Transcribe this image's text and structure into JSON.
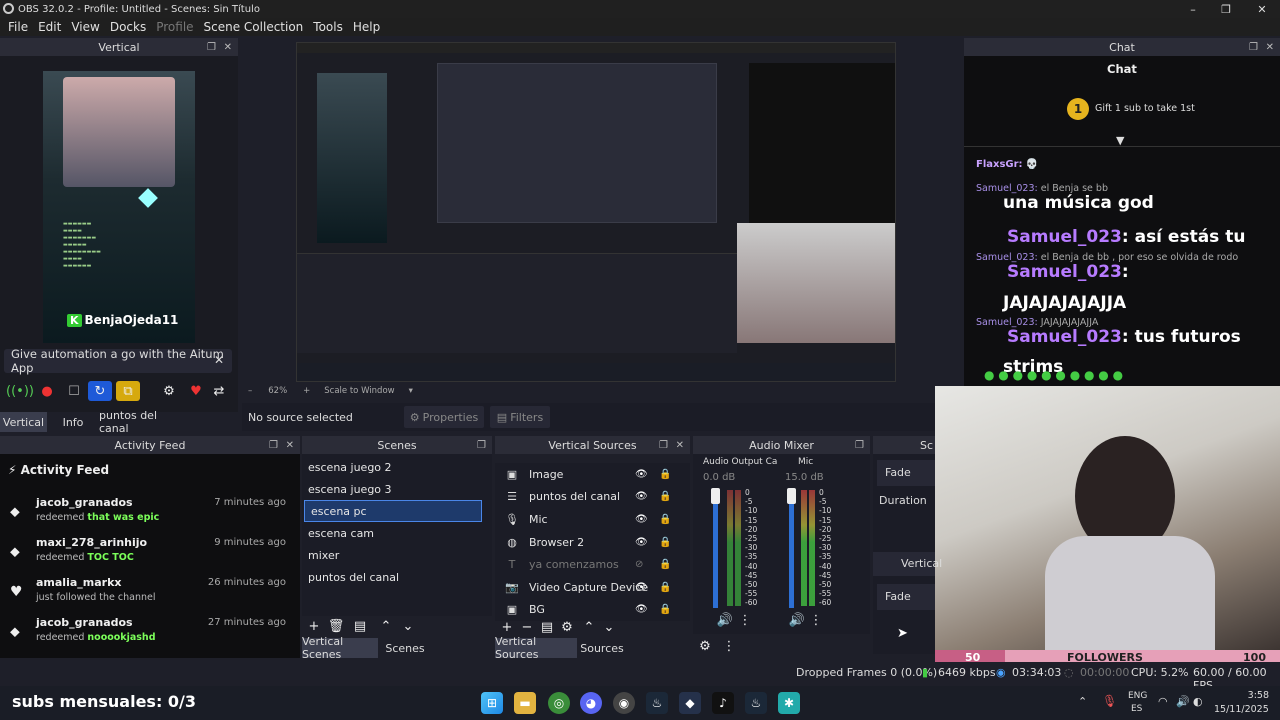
{
  "window": {
    "title": "OBS 32.0.2 - Profile: Untitled - Scenes: Sin Título",
    "controls": {
      "minimize": "–",
      "maximize": "❐",
      "close": "✕"
    }
  },
  "menu": [
    "File",
    "Edit",
    "View",
    "Docks",
    "Profile",
    "Scene Collection",
    "Tools",
    "Help"
  ],
  "vertical_dock": {
    "title": "Vertical",
    "preview_name": "BenjaOjeda11",
    "banner_text": "Give automation a go with the Aitum App",
    "tabs": [
      "Vertical",
      "Info",
      "puntos del canal"
    ]
  },
  "preview": {
    "zoom": "62%",
    "zoom_mode": "Scale to Window",
    "no_source_text": "No source selected",
    "properties_label": "Properties",
    "filters_label": "Filters"
  },
  "activity_feed": {
    "dock_title": "Activity Feed",
    "heading": "Activity Feed",
    "items": [
      {
        "user": "jacob_granados",
        "action": "redeemed",
        "detail": "that was epic",
        "time": "7 minutes ago",
        "icon": "points-icon"
      },
      {
        "user": "maxi_278_arinhijo",
        "action": "redeemed",
        "detail": "TOC TOC",
        "time": "9 minutes ago",
        "icon": "points-icon"
      },
      {
        "user": "amalia_markx",
        "action": "just followed the channel",
        "detail": "",
        "time": "26 minutes ago",
        "icon": "heart-icon"
      },
      {
        "user": "jacob_granados",
        "action": "redeemed",
        "detail": "nooookjashd",
        "time": "27 minutes ago",
        "icon": "points-icon"
      }
    ]
  },
  "scenes": {
    "title": "Scenes",
    "items": [
      "escena juego 2",
      "escena juego 3",
      "escena pc",
      "escena cam",
      "mixer",
      "puntos del canal"
    ],
    "selected": "escena pc",
    "tabs": [
      "Vertical Scenes",
      "Scenes"
    ]
  },
  "sources": {
    "title": "Vertical Sources",
    "items": [
      {
        "name": "Image",
        "icon": "image-icon",
        "visible": true
      },
      {
        "name": "puntos del canal",
        "icon": "list-icon",
        "visible": true
      },
      {
        "name": "Mic",
        "icon": "mic-icon",
        "visible": true
      },
      {
        "name": "Browser 2",
        "icon": "globe-icon",
        "visible": true
      },
      {
        "name": "ya comenzamos",
        "icon": "text-icon",
        "visible": false
      },
      {
        "name": "Video Capture Device",
        "icon": "camera-icon",
        "visible": true
      },
      {
        "name": "BG",
        "icon": "image-icon",
        "visible": true
      }
    ],
    "tabs": [
      "Vertical Sources",
      "Sources"
    ]
  },
  "audio_mixer": {
    "title": "Audio Mixer",
    "channels": [
      {
        "name": "Audio Output Ca",
        "db": "0.0 dB"
      },
      {
        "name": "Mic",
        "db": "15.0 dB"
      }
    ],
    "scale": [
      "0",
      "-5",
      "-10",
      "-15",
      "-20",
      "-25",
      "-30",
      "-35",
      "-40",
      "-45",
      "-50",
      "-55",
      "-60"
    ]
  },
  "transitions": {
    "title": "Sc",
    "fade": "Fade",
    "duration_label": "Duration",
    "vertical_label": "Vertical",
    "vertical_fade": "Fade"
  },
  "chat": {
    "dock_title": "Chat",
    "header": "Chat",
    "gift_rank": "1",
    "gift_text": "Gift 1 sub to take 1st",
    "lines": [
      {
        "user": "FlaxsGr:",
        "text": "💀"
      },
      {
        "user": "Samuel_023:",
        "text": "el Benja se bb"
      },
      {
        "user": "",
        "text": "una música god"
      },
      {
        "user": "Samuel_023",
        "text": ": así estás tu"
      },
      {
        "user": "Samuel_023:",
        "text": "el Benja de bb , por eso se olvida de rodo"
      },
      {
        "user": "Samuel_023",
        "text": ":"
      },
      {
        "user": "",
        "text": "JAJAJAJAJAJJA"
      },
      {
        "user": "Samuel_023:",
        "text": "JAJAJAJAJAJJA"
      },
      {
        "user": "Samuel_023",
        "text": ": tus futuros"
      },
      {
        "user": "",
        "text": "strims"
      }
    ]
  },
  "followers_bar": {
    "left": "50",
    "label": "FOLLOWERS",
    "right": "100"
  },
  "status_bar": {
    "dropped": "Dropped Frames 0 (0.0%)",
    "bitrate": "6469 kbps",
    "rec_time": "03:34:03",
    "stream_time": "00:00:00",
    "cpu": "CPU: 5.2%",
    "fps": "60.00 / 60.00 FPS"
  },
  "overlay": {
    "subs_text": "subs mensuales: 0/3"
  },
  "taskbar": {
    "lang": "ENG",
    "lang2": "ES",
    "time": "3:58",
    "date": "15/11/2025"
  },
  "colors": {
    "accent": "#1e88e5",
    "selected": "#1e3a6b",
    "twitch_purple": "#b77bff",
    "follower_pink": "#e6a0b8"
  }
}
